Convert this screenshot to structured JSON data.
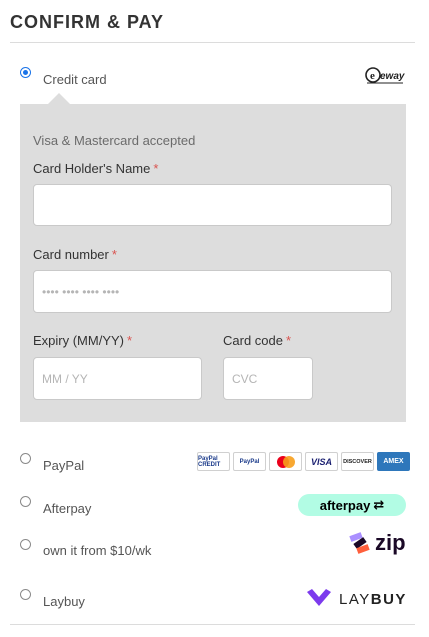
{
  "section": {
    "title": "CONFIRM & PAY"
  },
  "options": {
    "credit_card": {
      "label": "Credit card",
      "selected": true,
      "logo_text": "eway",
      "accepted_text": "Visa & Mastercard accepted",
      "holder_label": "Card Holder's Name",
      "number_label": "Card number",
      "number_placeholder": "•••• •••• •••• ••••",
      "expiry_label": "Expiry (MM/YY)",
      "expiry_placeholder": "MM / YY",
      "code_label": "Card code",
      "code_placeholder": "CVC",
      "required_mark": "*"
    },
    "paypal": {
      "label": "PayPal",
      "icons": [
        "PayPal CREDIT",
        "PayPal",
        "Mastercard",
        "VISA",
        "DISCOVER",
        "AMEX"
      ]
    },
    "afterpay": {
      "label": "Afterpay",
      "logo_text": "afterpay"
    },
    "zip": {
      "label": "own it from $10/wk",
      "logo_text": "zip"
    },
    "laybuy": {
      "label": "Laybuy",
      "logo_text_light": "LAY",
      "logo_text_bold": "BUY"
    }
  },
  "colors": {
    "accent": "#1a73e8",
    "panel_bg": "#dddddd",
    "required": "#d9534f",
    "afterpay_mint": "#b2fce4",
    "laybuy_purple": "#7c3aed"
  }
}
